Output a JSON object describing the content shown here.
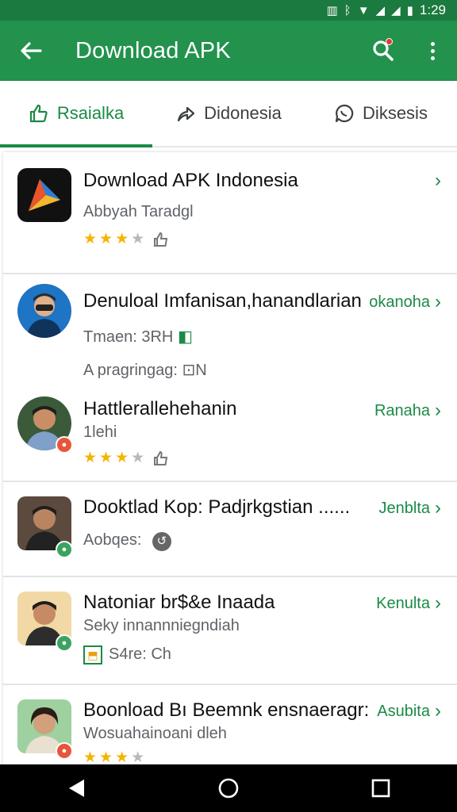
{
  "status_bar": {
    "time": "1:29"
  },
  "app_bar": {
    "title": "Download APK"
  },
  "tabs": [
    {
      "label": "Rsaialka",
      "icon": "thumbs-up-icon",
      "active": true
    },
    {
      "label": "Didonesia",
      "icon": "share-icon",
      "active": false
    },
    {
      "label": "Diksesis",
      "icon": "chat-icon",
      "active": false
    }
  ],
  "items": [
    {
      "title": "Download APK Indonesia",
      "subtitle": "Abbyah Taradgl",
      "rating": 3
    },
    {
      "title": "Denuloal Imfanisan,hanandlarian",
      "action": "okanoha",
      "line2": "Tmaen: 3RH",
      "line3": "A pragringag: ⊡N"
    },
    {
      "title": "Hattlerallehehanin",
      "action": "Ranaha",
      "subtitle": "1lehi",
      "rating": 3
    },
    {
      "title": "Dooktlad Kop: Padjrkgstian ......",
      "action": "Jenblta",
      "subtitle": "Aobqes:"
    },
    {
      "title": "Natoniar br$&e Inaada",
      "action": "Kenulta",
      "subtitle": "Seky innannniegndiah",
      "line3": "S4re: Ch"
    },
    {
      "title": "Boonload Bı Beemnk ensnaeragr:",
      "action": "Asubita",
      "subtitle": "Wosuahainoani dleh",
      "rating": 3
    }
  ],
  "colors": {
    "primary": "#22924d",
    "accent": "#1b8a46",
    "star": "#f4b400"
  }
}
